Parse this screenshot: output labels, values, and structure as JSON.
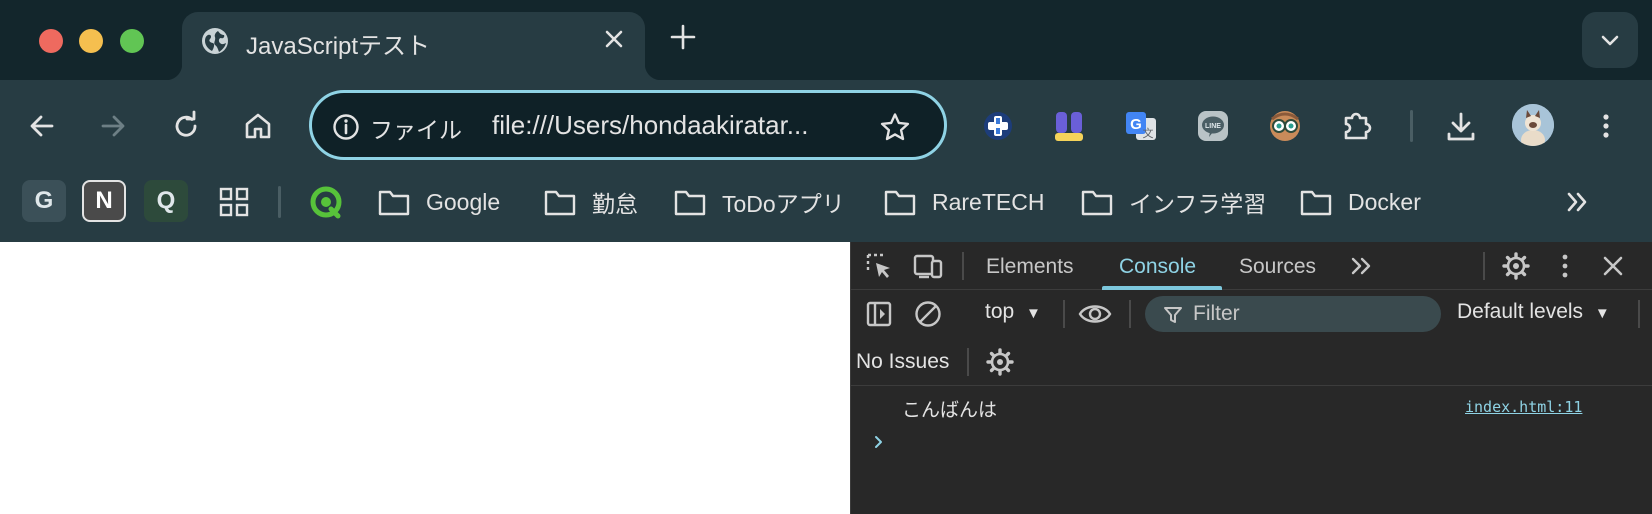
{
  "window": {
    "controls": [
      "close",
      "minimize",
      "maximize"
    ]
  },
  "tab": {
    "title": "JavaScriptテスト",
    "icon": "globe-icon"
  },
  "toolbar": {
    "omnibox": {
      "chip_label": "ファイル",
      "url": "file:///Users/hondaakiratar..."
    },
    "extensions": [
      "puzzle-cross-icon",
      "profile-stack-icon",
      "google-translate-icon",
      "line-icon",
      "owl-glasses-icon",
      "extensions-puzzle-icon"
    ]
  },
  "bookmarks": {
    "tiles": [
      "G",
      "N",
      "Q"
    ],
    "folders": [
      "Google",
      "勤怠",
      "ToDoアプリ",
      "RareTECH",
      "インフラ学習",
      "Docker"
    ]
  },
  "devtools": {
    "tabs": [
      "Elements",
      "Console",
      "Sources"
    ],
    "active_tab": "Console",
    "context": "top",
    "filter_placeholder": "Filter",
    "levels": "Default levels",
    "issues": "No Issues",
    "console_message": "こんばんは",
    "source_link": "index.html:11"
  },
  "colors": {
    "tabstrip": "#13262c",
    "toolbar": "#273c43",
    "omnibox_border": "#8fd3e5",
    "devtools_bg": "#282828",
    "accent": "#8fd3e5"
  }
}
